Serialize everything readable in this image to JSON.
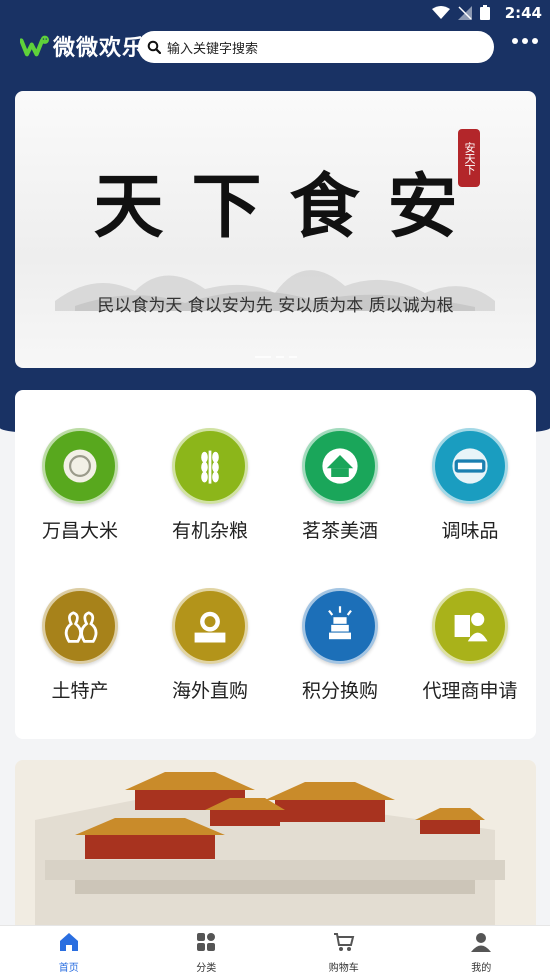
{
  "status_bar": {
    "time": "2:44"
  },
  "header": {
    "logo_text": "微微欢乐",
    "search_placeholder": "输入关键字搜索"
  },
  "banner": {
    "title": "天下食安",
    "seal": "安天下",
    "subtitle": "民以食为天 食以安为先 安以质为本 质以诚为根",
    "slide_count": 3,
    "active_slide": 1
  },
  "categories": [
    {
      "label": "万昌大米",
      "color": "#58a81e",
      "icon": "rice-icon"
    },
    {
      "label": "有机杂粮",
      "color": "#8cb61a",
      "icon": "wheat-icon"
    },
    {
      "label": "茗茶美酒",
      "color": "#1aa65a",
      "icon": "pavilion-icon"
    },
    {
      "label": "调味品",
      "color": "#1a9dc0",
      "icon": "jiangcheng-icon"
    },
    {
      "label": "土特产",
      "color": "#a7821a",
      "icon": "gourd-icon"
    },
    {
      "label": "海外直购",
      "color": "#b3941a",
      "icon": "maoshanwang-icon"
    },
    {
      "label": "积分换购",
      "color": "#1c6fb8",
      "icon": "gold-bars-icon"
    },
    {
      "label": "代理商申请",
      "color": "#a9b21a",
      "icon": "agent-icon"
    }
  ],
  "tabs": [
    {
      "label": "首页",
      "icon": "home-icon"
    },
    {
      "label": "分类",
      "icon": "category-icon"
    },
    {
      "label": "购物车",
      "icon": "cart-icon"
    },
    {
      "label": "我的",
      "icon": "user-icon"
    }
  ],
  "active_tab": 0
}
